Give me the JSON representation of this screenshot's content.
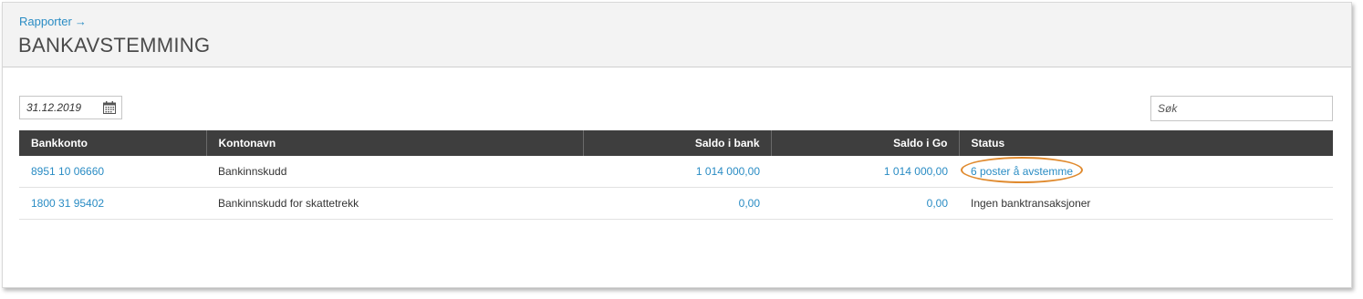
{
  "header": {
    "breadcrumb": "Rapporter",
    "breadcrumb_arrow": "→",
    "title": "BANKAVSTEMMING"
  },
  "filters": {
    "date_value": "31.12.2019",
    "date_icon": "calendar-icon",
    "search_placeholder": "Søk"
  },
  "table": {
    "columns": [
      "Bankkonto",
      "Kontonavn",
      "Saldo i bank",
      "Saldo i Go",
      "Status"
    ],
    "rows": [
      {
        "account": "8951 10 06660",
        "name": "Bankinnskudd",
        "bank_balance": "1 014 000,00",
        "go_balance": "1 014 000,00",
        "status": "6 poster å avstemme"
      },
      {
        "account": "1800 31 95402",
        "name": "Bankinnskudd for skattetrekk",
        "bank_balance": "0,00",
        "go_balance": "0,00",
        "status": "Ingen banktransaksjoner"
      }
    ]
  },
  "colors": {
    "link": "#2a8cc4",
    "header_bg": "#3e3e3e",
    "highlight": "#e08a2e"
  }
}
